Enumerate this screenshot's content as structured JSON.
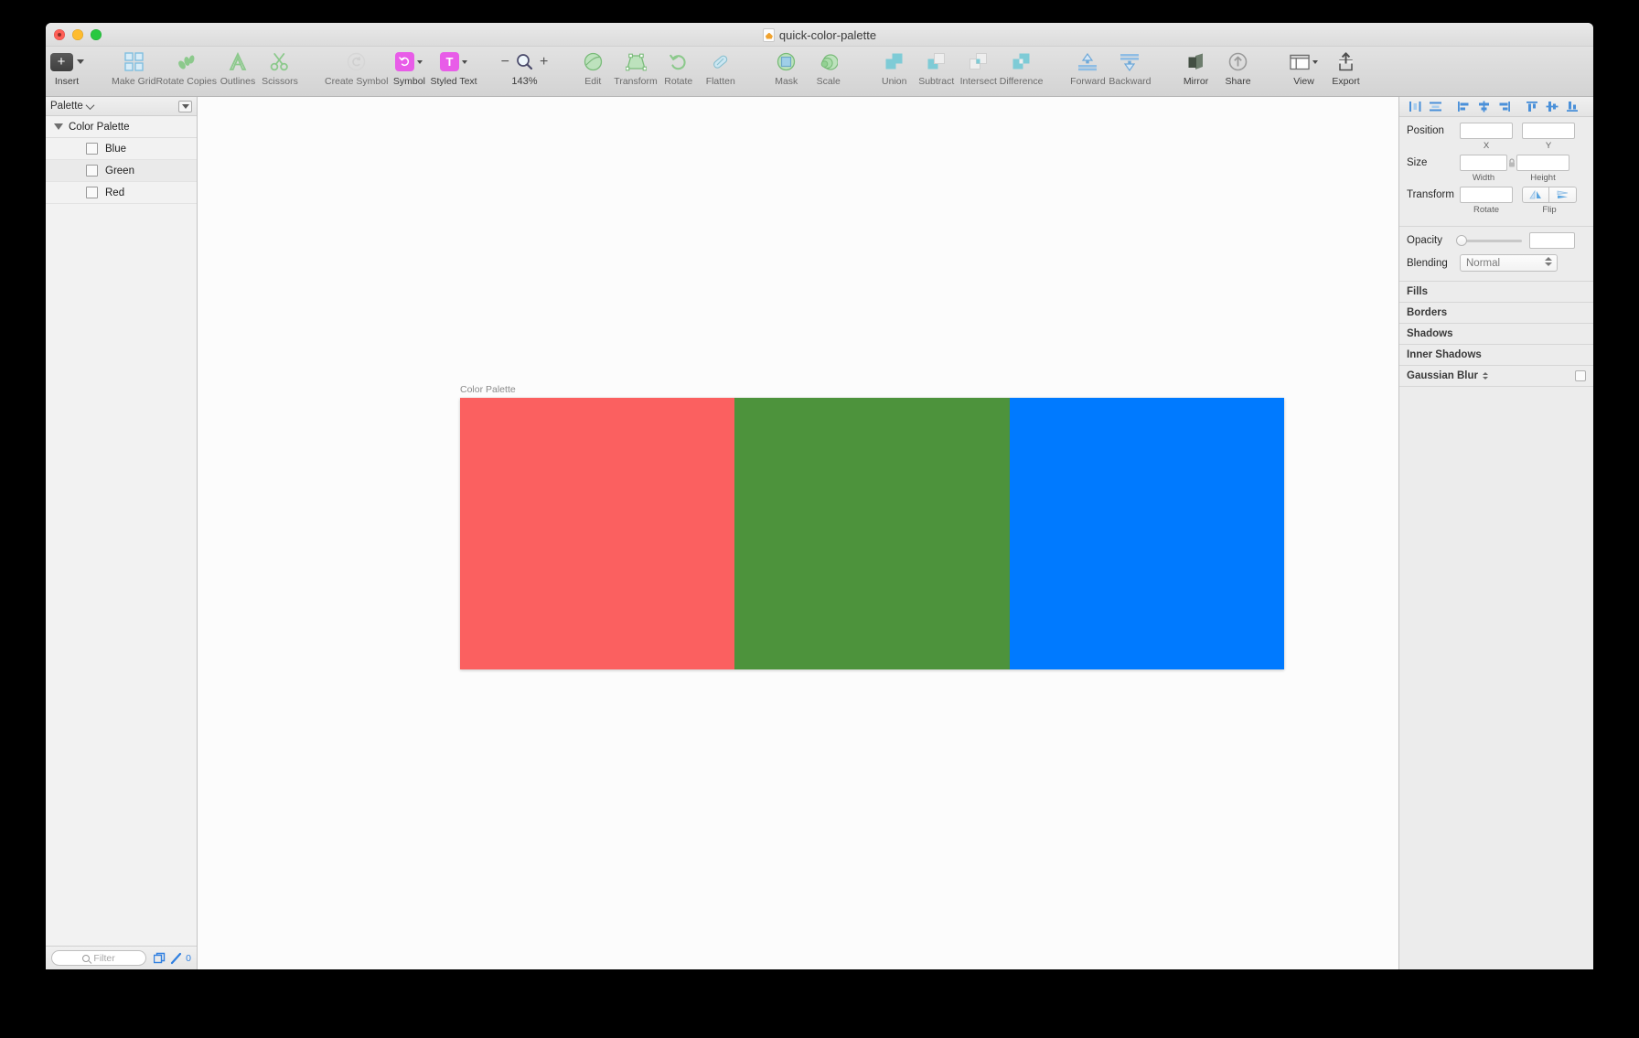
{
  "window": {
    "title": "quick-color-palette",
    "doc_icon": "document-icon",
    "traffic_lights": [
      "close",
      "minimize",
      "maximize"
    ]
  },
  "toolbar": {
    "groups": [
      {
        "name": "insert-group",
        "items": [
          {
            "label": "Insert",
            "icon": "plus-button-icon",
            "dark": true,
            "type": "insert"
          }
        ]
      },
      {
        "name": "shape-tools-group",
        "items": [
          {
            "label": "Make Grid",
            "icon": "grid-icon",
            "type": "plain"
          },
          {
            "label": "Rotate Copies",
            "icon": "rotate-copies-icon",
            "type": "plain"
          },
          {
            "label": "Outlines",
            "icon": "outlines-icon",
            "type": "plain"
          },
          {
            "label": "Scissors",
            "icon": "scissors-icon",
            "type": "plain"
          }
        ]
      },
      {
        "name": "symbol-group",
        "items": [
          {
            "label": "Create Symbol",
            "icon": "create-symbol-icon",
            "type": "plain"
          },
          {
            "label": "Symbol",
            "icon": "symbol-icon",
            "dark": true,
            "type": "badge-symbol"
          },
          {
            "label": "Styled Text",
            "icon": "styled-text-icon",
            "dark": true,
            "type": "badge-text"
          }
        ]
      },
      {
        "name": "zoom-group",
        "items": [
          {
            "label": "143%",
            "icon": "magnifier-icon",
            "dark": true,
            "type": "zoom"
          }
        ]
      },
      {
        "name": "edit-group",
        "items": [
          {
            "label": "Edit",
            "icon": "edit-icon",
            "type": "plain"
          },
          {
            "label": "Transform",
            "icon": "transform-icon",
            "type": "plain"
          },
          {
            "label": "Rotate",
            "icon": "rotate-icon",
            "type": "plain"
          },
          {
            "label": "Flatten",
            "icon": "flatten-icon",
            "type": "plain"
          }
        ]
      },
      {
        "name": "mask-group",
        "items": [
          {
            "label": "Mask",
            "icon": "mask-icon",
            "type": "plain"
          },
          {
            "label": "Scale",
            "icon": "scale-icon",
            "type": "plain"
          }
        ]
      },
      {
        "name": "boolean-group",
        "items": [
          {
            "label": "Union",
            "icon": "union-icon",
            "type": "plain"
          },
          {
            "label": "Subtract",
            "icon": "subtract-icon",
            "type": "plain"
          },
          {
            "label": "Intersect",
            "icon": "intersect-icon",
            "type": "plain"
          },
          {
            "label": "Difference",
            "icon": "difference-icon",
            "type": "plain"
          }
        ]
      },
      {
        "name": "arrange-group",
        "items": [
          {
            "label": "Forward",
            "icon": "forward-icon",
            "type": "plain"
          },
          {
            "label": "Backward",
            "icon": "backward-icon",
            "type": "plain"
          }
        ]
      },
      {
        "name": "share-group",
        "items": [
          {
            "label": "Mirror",
            "icon": "mirror-icon",
            "dark": true,
            "type": "plain"
          },
          {
            "label": "Share",
            "icon": "share-icon",
            "dark": true,
            "type": "plain"
          }
        ]
      },
      {
        "name": "view-group",
        "items": [
          {
            "label": "View",
            "icon": "view-icon",
            "dark": true,
            "type": "view"
          },
          {
            "label": "Export",
            "icon": "export-icon",
            "dark": true,
            "type": "plain"
          }
        ]
      }
    ]
  },
  "sidebar": {
    "header": {
      "title": "Palette",
      "menu_icon": "dropdown-button-icon"
    },
    "group": {
      "name": "Color Palette",
      "expanded": true
    },
    "layers": [
      {
        "name": "Blue",
        "checkbox": false
      },
      {
        "name": "Green",
        "checkbox": false
      },
      {
        "name": "Red",
        "checkbox": false
      }
    ],
    "footer": {
      "filter_placeholder": "Filter",
      "filter_value": "",
      "duplicate_icon": "duplicate-icon",
      "pen_icon": "pen-icon",
      "count": "0"
    }
  },
  "canvas": {
    "artboard_label": "Color Palette",
    "swatches": [
      {
        "name": "Red",
        "color": "#FB6060",
        "flex": 1
      },
      {
        "name": "Green",
        "color": "#4D933C",
        "flex": 1
      },
      {
        "name": "Blue",
        "color": "#007AFF",
        "flex": 1
      }
    ],
    "background": "#FCFCFC"
  },
  "inspector": {
    "align_buttons": [
      "align-distribute-horizontal-icon",
      "align-distribute-vertical-icon",
      "align-left-icon",
      "align-center-horizontal-icon",
      "align-right-icon",
      "align-top-icon",
      "align-middle-vertical-icon",
      "align-bottom-icon"
    ],
    "position": {
      "label": "Position",
      "x_value": "",
      "y_value": "",
      "x_sub": "X",
      "y_sub": "Y"
    },
    "size": {
      "label": "Size",
      "width_value": "",
      "height_value": "",
      "width_sub": "Width",
      "height_sub": "Height",
      "lock_icon": "lock-icon"
    },
    "transform": {
      "label": "Transform",
      "rotate_value": "",
      "rotate_sub": "Rotate",
      "flip_sub": "Flip",
      "flip_h_icon": "flip-horizontal-icon",
      "flip_v_icon": "flip-vertical-icon"
    },
    "opacity": {
      "label": "Opacity",
      "value": "",
      "slider_position": 0
    },
    "blending": {
      "label": "Blending",
      "value": "Normal"
    },
    "panels": [
      {
        "title": "Fills",
        "has_stepper": false,
        "has_checkbox": false
      },
      {
        "title": "Borders",
        "has_stepper": false,
        "has_checkbox": false
      },
      {
        "title": "Shadows",
        "has_stepper": false,
        "has_checkbox": false
      },
      {
        "title": "Inner Shadows",
        "has_stepper": false,
        "has_checkbox": false
      },
      {
        "title": "Gaussian Blur",
        "has_stepper": true,
        "has_checkbox": true
      }
    ]
  }
}
